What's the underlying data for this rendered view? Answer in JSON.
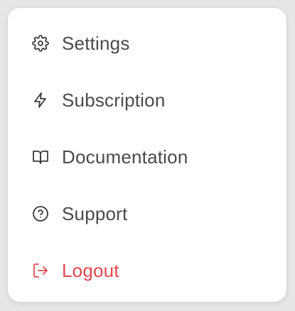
{
  "menu": {
    "items": [
      {
        "label": "Settings",
        "icon": "gear-icon"
      },
      {
        "label": "Subscription",
        "icon": "lightning-bolt-icon"
      },
      {
        "label": "Documentation",
        "icon": "open-book-icon"
      },
      {
        "label": "Support",
        "icon": "question-circle-icon"
      },
      {
        "label": "Logout",
        "icon": "logout-icon"
      }
    ]
  },
  "colors": {
    "text": "#4a4a4a",
    "icon": "#3a3a3a",
    "danger": "#e5484d",
    "background": "#ffffff",
    "border": "#d8d8d8"
  }
}
